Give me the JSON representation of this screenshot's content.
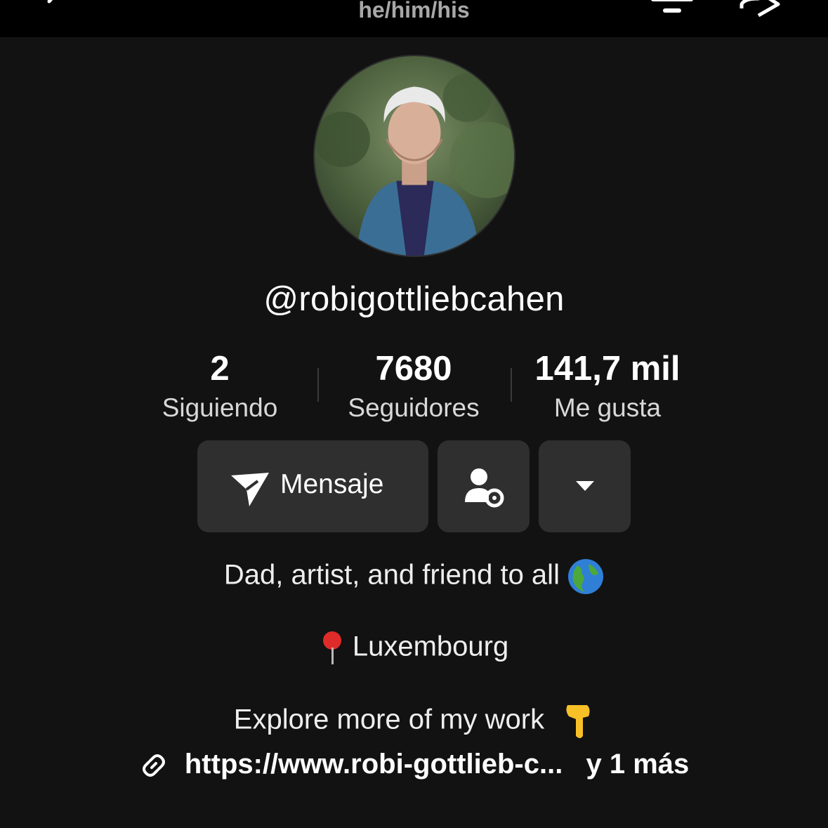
{
  "header": {
    "pronouns": "he/him/his",
    "icons": [
      "back-icon",
      "notification-settings-icon",
      "share-icon"
    ]
  },
  "profile": {
    "avatar_alt": "profile photo",
    "username": "@robigottliebcahen"
  },
  "stats": [
    {
      "value": "2",
      "label": "Siguiendo"
    },
    {
      "value": "7680",
      "label": "Seguidores"
    },
    {
      "value": "141,7 mil",
      "label": "Me gusta"
    }
  ],
  "actions": {
    "message_label": "Mensaje",
    "icons": [
      "send-icon",
      "friend-settings-icon",
      "caret-down-icon"
    ]
  },
  "bio": {
    "line1": "Dad, artist, and friend to all",
    "line1_emoji": "globe-icon",
    "line2": "Luxembourg",
    "line2_emoji": "pin-icon",
    "line3": "Explore more of my work",
    "line3_emoji": "pointing-down-icon"
  },
  "link": {
    "url": "https://www.robi-gottlieb-c...",
    "more": "y 1 más"
  },
  "colors": {
    "background": "#121212",
    "topbar": "#000000",
    "button": "#2f2f2f",
    "secondary_text": "#a8a8a8"
  }
}
